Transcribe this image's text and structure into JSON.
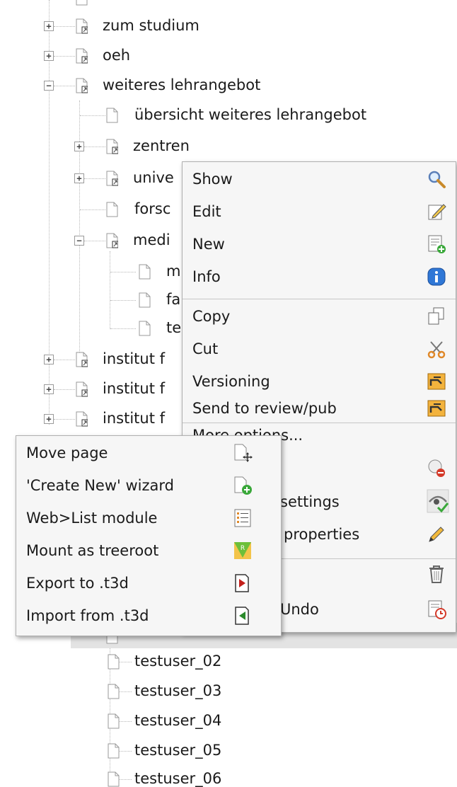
{
  "tree": {
    "nodes": [
      {
        "label": "zum studium"
      },
      {
        "label": "oeh"
      },
      {
        "label": "weiteres lehrangebot"
      },
      {
        "label": "übersicht weiteres lehrangebot"
      },
      {
        "label": "zentren"
      },
      {
        "label": "unive"
      },
      {
        "label": "forsc"
      },
      {
        "label": "medi"
      },
      {
        "label": "m"
      },
      {
        "label": "fa"
      },
      {
        "label": "te"
      },
      {
        "label": "institut f"
      },
      {
        "label": "institut f"
      },
      {
        "label": "institut f"
      },
      {
        "label": "testuser_02"
      },
      {
        "label": "testuser_03"
      },
      {
        "label": "testuser_04"
      },
      {
        "label": "testuser_05"
      },
      {
        "label": "testuser_06"
      }
    ]
  },
  "context_menu": {
    "items": [
      {
        "label": "Show",
        "icon": "magnifier-icon"
      },
      {
        "label": "Edit",
        "icon": "edit-page-icon"
      },
      {
        "label": "New",
        "icon": "new-page-icon"
      },
      {
        "label": "Info",
        "icon": "info-icon"
      },
      {
        "label": "Copy",
        "icon": "copy-icon"
      },
      {
        "label": "Cut",
        "icon": "scissors-icon"
      },
      {
        "label": "Versioning",
        "icon": "versioning-icon"
      },
      {
        "label": "Send to review/pub",
        "icon": "send-review-icon"
      },
      {
        "label": "More options...",
        "icon": ""
      },
      {
        "label": "",
        "icon": "hide-page-icon"
      },
      {
        "label": "settings",
        "icon": "eye-settings-icon"
      },
      {
        "label": "properties",
        "icon": "pencil-icon"
      },
      {
        "label": "",
        "icon": "trash-icon"
      },
      {
        "label": "Undo",
        "icon": "history-clock-icon"
      }
    ]
  },
  "submenu": {
    "items": [
      {
        "label": "Move page",
        "icon": "move-page-icon"
      },
      {
        "label": "'Create New' wizard",
        "icon": "new-wizard-icon"
      },
      {
        "label": "Web>List module",
        "icon": "list-module-icon"
      },
      {
        "label": "Mount as treeroot",
        "icon": "treeroot-icon"
      },
      {
        "label": "Export to .t3d",
        "icon": "export-icon"
      },
      {
        "label": "Import from .t3d",
        "icon": "import-icon"
      }
    ]
  },
  "colors": {
    "menu_background": "#f6f6f6",
    "menu_border": "#b0b0b0",
    "highlight_row": "#e3e3e3",
    "info_blue": "#2f77d6",
    "add_green": "#3aa83a",
    "delete_red": "#d43a2a"
  }
}
